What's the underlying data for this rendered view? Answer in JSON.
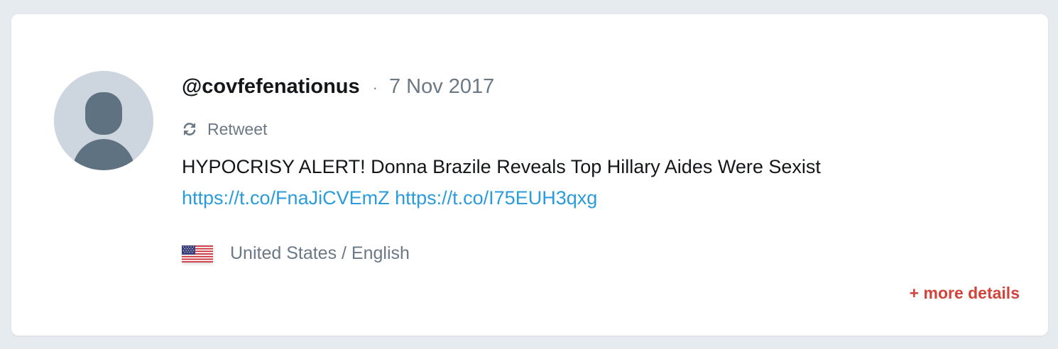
{
  "tweet": {
    "handle": "@covfefenationus",
    "separator": "·",
    "date": "7 Nov 2017",
    "type_label": "Retweet",
    "text_prefix": "HYPOCRISY ALERT! Donna Brazile Reveals Top Hillary Aides Were Sexist",
    "links": [
      "https://t.co/FnaJiCVEmZ",
      "https://t.co/I75EUH3qxg"
    ],
    "location_language": "United States / English",
    "flag_icon": "us-flag-icon",
    "avatar_icon": "default-avatar-icon",
    "retweet_icon": "retweet-icon"
  },
  "actions": {
    "more_details_label": "+ more details"
  },
  "colors": {
    "background": "#e6ebf0",
    "card": "#ffffff",
    "link": "#2a9cdc",
    "accent": "#d0443c",
    "muted": "#6b7885",
    "avatar_bg": "#cdd5de",
    "avatar_fg": "#5f7282"
  }
}
